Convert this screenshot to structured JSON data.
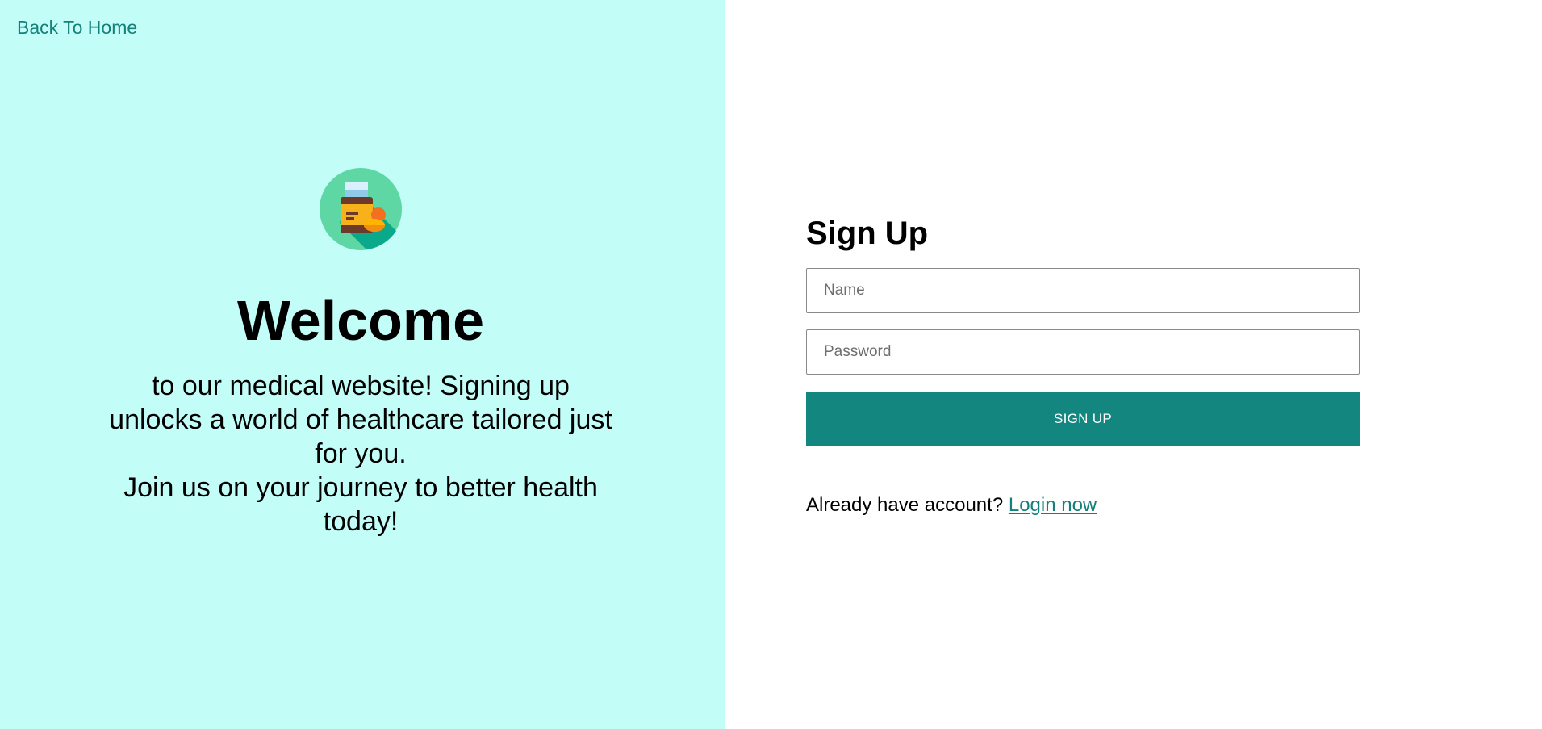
{
  "nav": {
    "back_label": "Back To Home"
  },
  "hero": {
    "logo_icon": "medicine-bottle-icon",
    "heading": "Welcome",
    "tagline_line1": "to our medical website! Signing up unlocks a world of healthcare tailored just for you.",
    "tagline_line2": "Join us on your journey to better health today!"
  },
  "form": {
    "title": "Sign Up",
    "name_placeholder": "Name",
    "password_placeholder": "Password",
    "submit_label": "SIGN UP",
    "login_prompt": "Already have account?",
    "login_link": "Login now"
  },
  "colors": {
    "left_panel_bg": "#c3fdf8",
    "accent": "#138680",
    "link": "#14807a"
  }
}
